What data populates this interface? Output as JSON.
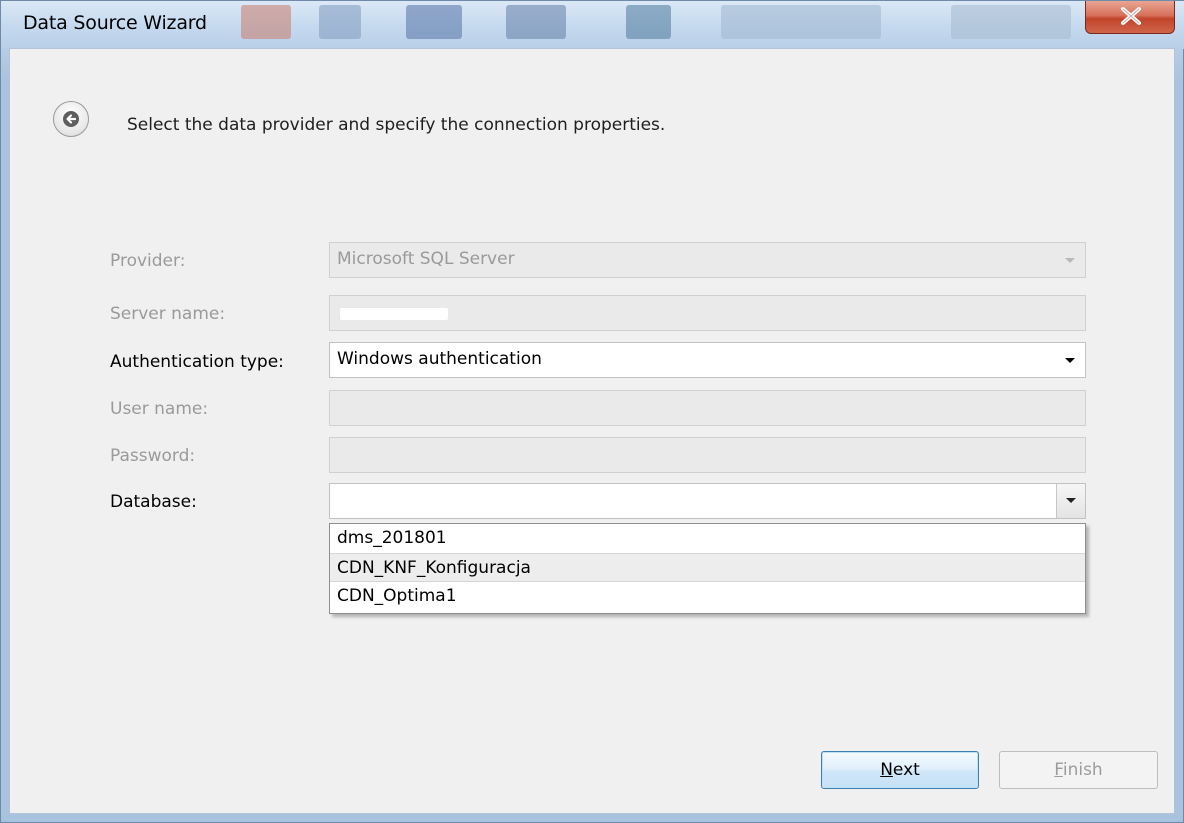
{
  "window": {
    "title": "Data Source Wizard"
  },
  "header": {
    "instruction": "Select the data provider and specify the connection properties."
  },
  "form": {
    "provider": {
      "label": "Provider:",
      "value": "Microsoft SQL Server",
      "enabled": false
    },
    "server_name": {
      "label": "Server name:",
      "value": "",
      "enabled": false
    },
    "authentication_type": {
      "label": "Authentication type:",
      "value": "Windows authentication",
      "enabled": true
    },
    "user_name": {
      "label": "User name:",
      "value": "",
      "enabled": false
    },
    "password": {
      "label": "Password:",
      "value": "",
      "enabled": false
    },
    "database": {
      "label": "Database:",
      "value": "",
      "enabled": true,
      "options": [
        "dms_201801",
        "CDN_KNF_Konfiguracja",
        "CDN_Optima1"
      ],
      "hovered_option": "CDN_KNF_Konfiguracja"
    }
  },
  "buttons": {
    "next": {
      "mnemonic": "N",
      "rest": "ext"
    },
    "finish": {
      "mnemonic": "F",
      "rest": "inish"
    }
  },
  "icons": {
    "back": "back-arrow-icon",
    "close": "close-icon"
  },
  "colors": {
    "close_button": "#c1442a",
    "next_button_border": "#3c7fb1",
    "disabled_text": "#9a9a9a"
  }
}
